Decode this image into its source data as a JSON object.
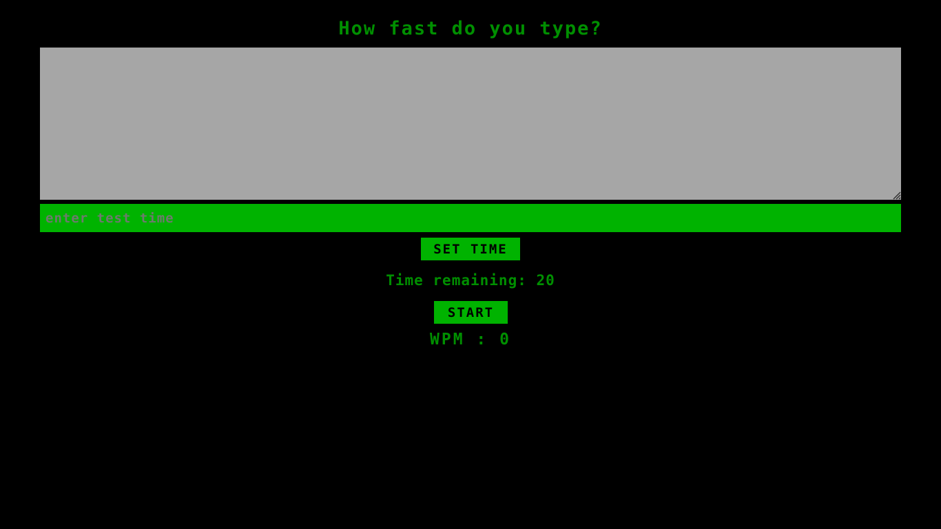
{
  "app": {
    "title": "How fast do you type?",
    "background_color": "#000000",
    "accent_green": "#00b300",
    "text_green": "#008f00",
    "textarea_gray": "#a6a6a6",
    "placeholder_gray": "#6d7a6d"
  },
  "typing_area": {
    "value": "",
    "placeholder": "",
    "resize_handle_icon": "resize-grip-icon"
  },
  "time_input": {
    "value": "",
    "placeholder": "enter test time"
  },
  "buttons": {
    "set_time_label": "SET TIME",
    "start_label": "START"
  },
  "status": {
    "time_remaining_label": "Time remaining:",
    "time_remaining_value": "20",
    "time_remaining_text": "Time remaining: 20",
    "wpm_label": "WPM",
    "wpm_separator": ":",
    "wpm_value": "0",
    "wpm_text": "WPM : 0"
  }
}
